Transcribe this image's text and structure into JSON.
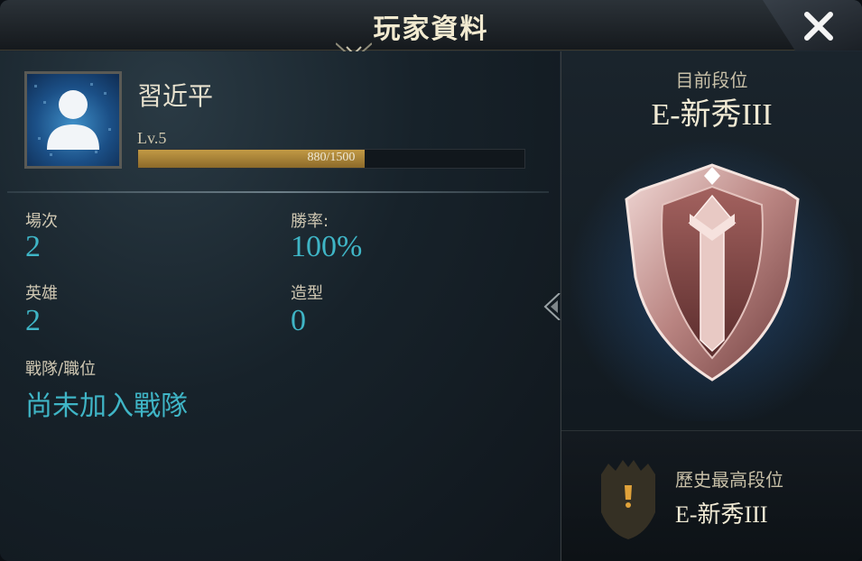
{
  "header": {
    "title": "玩家資料"
  },
  "player": {
    "name": "習近平",
    "level": "Lv.5",
    "xp_text": "880/1500",
    "xp_progress": 0.5867
  },
  "stats": {
    "matches_label": "場次",
    "matches_value": "2",
    "winrate_label": "勝率:",
    "winrate_value": "100%",
    "heroes_label": "英雄",
    "heroes_value": "2",
    "skins_label": "造型",
    "skins_value": "0",
    "team_label": "戰隊/職位",
    "team_value": "尚未加入戰隊"
  },
  "rank": {
    "current_label": "目前段位",
    "current_value": "E-新秀III",
    "history_label": "歷史最高段位",
    "history_value": "E-新秀III"
  },
  "icons": {
    "close": "close-icon",
    "avatar": "default-avatar-icon",
    "emblem": "rank-shield-emblem",
    "history": "rank-history-emblem"
  },
  "colors": {
    "accent_value": "#3fb5c6",
    "xp_fill": "#c29a45",
    "title_text": "#f2ead0"
  }
}
